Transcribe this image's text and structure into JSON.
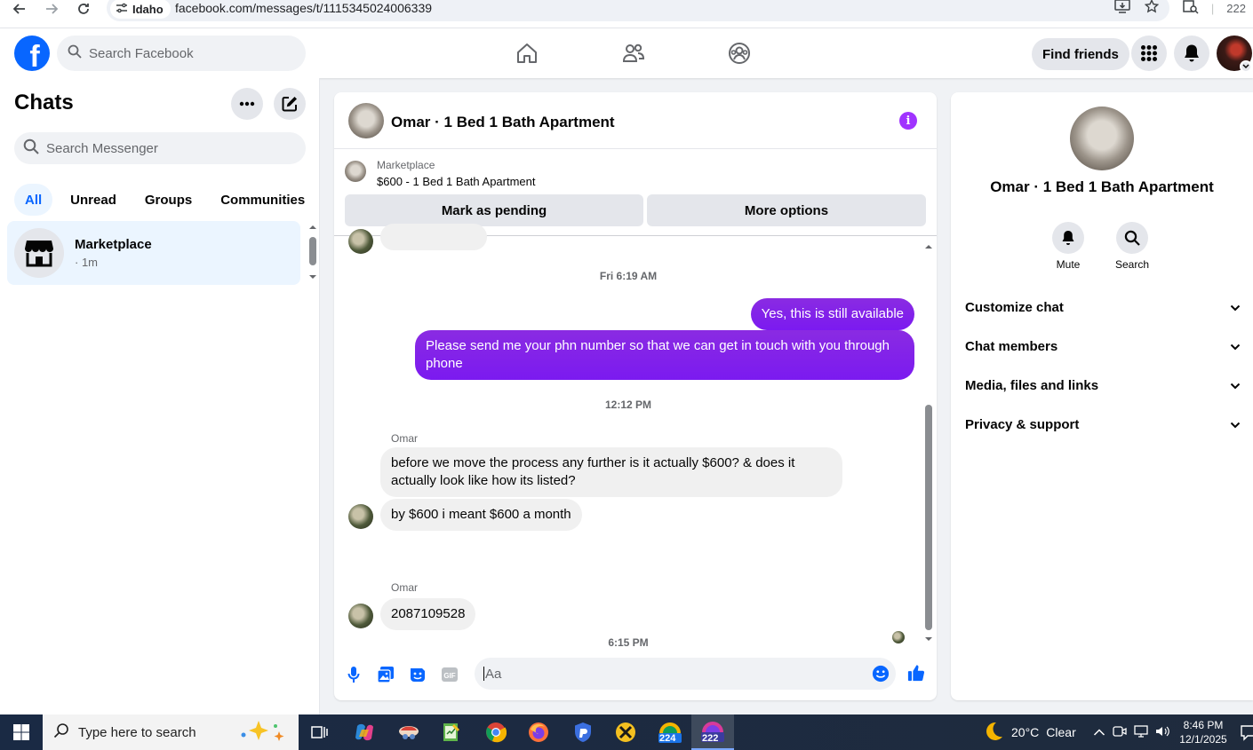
{
  "browser": {
    "location_chip": "Idaho",
    "url": "facebook.com/messages/t/1115345024006339",
    "profile_count": "222"
  },
  "fbnav": {
    "search_placeholder": "Search Facebook",
    "find_friends": "Find friends"
  },
  "sidebar": {
    "title": "Chats",
    "search_placeholder": "Search Messenger",
    "filters": [
      "All",
      "Unread",
      "Groups",
      "Communities"
    ],
    "chats": [
      {
        "name": "Marketplace",
        "meta": "· 1m"
      }
    ]
  },
  "conversation": {
    "title": "Omar · 1 Bed 1 Bath Apartment",
    "marketplace_label": "Marketplace",
    "listing": "$600 - 1 Bed 1 Bath Apartment",
    "mark_pending": "Mark as pending",
    "more_options": "More options",
    "messages": {
      "ts1": "Fri 6:19 AM",
      "out1": "Yes, this is still available",
      "out2": "Please send me your phn number so that we can get in touch with you through phone",
      "ts2": "12:12 PM",
      "sender1": "Omar",
      "in1": "before we move the process any further is it actually $600? & does it actually look like how its listed?",
      "in2": "by $600 i meant $600 a month",
      "ts3": "6:15 PM",
      "sender2": "Omar",
      "in3": "2087109528"
    },
    "composer_placeholder": "Aa"
  },
  "rightpanel": {
    "title": "Omar · 1 Bed 1 Bath Apartment",
    "mute": "Mute",
    "search": "Search",
    "sections": [
      "Customize chat",
      "Chat members",
      "Media, files and links",
      "Privacy & support"
    ]
  },
  "taskbar": {
    "search_placeholder": "Type here to search",
    "app_badge_1": "224",
    "app_badge_2": "222",
    "temperature": "20°C",
    "weather": "Clear",
    "time": "8:46 PM",
    "date": "12/1/2025"
  },
  "colors": {
    "brand": "#0866ff",
    "outgoing_bubble": "#8a2be2",
    "info_accent": "#a033ff"
  }
}
